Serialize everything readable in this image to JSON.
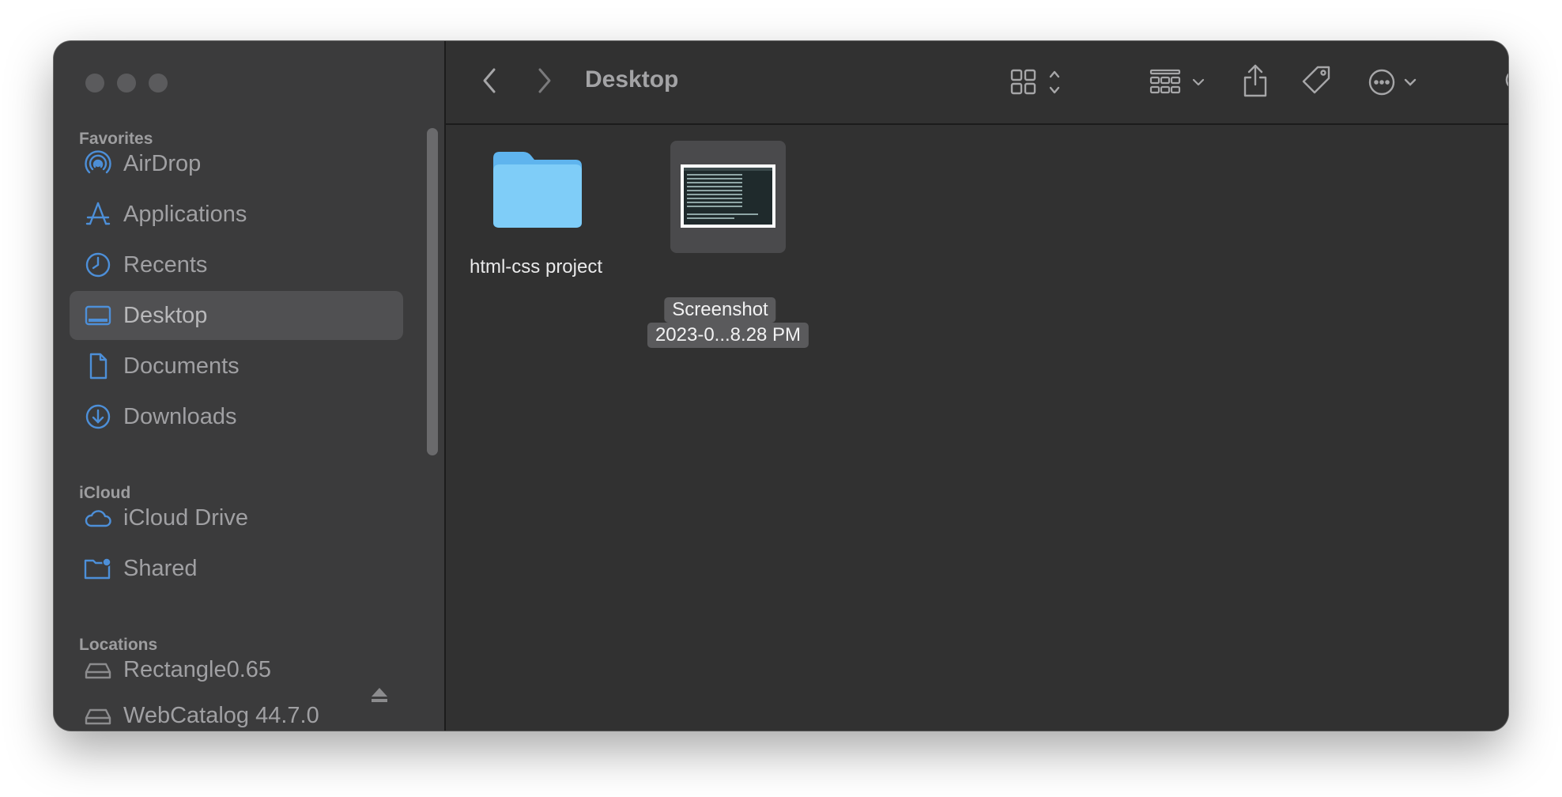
{
  "window": {
    "title": "Desktop"
  },
  "sidebar": {
    "favorites_title": "Favorites",
    "icloud_title": "iCloud",
    "locations_title": "Locations",
    "favorites": [
      {
        "label": "AirDrop",
        "icon": "airdrop-icon"
      },
      {
        "label": "Applications",
        "icon": "applications-icon"
      },
      {
        "label": "Recents",
        "icon": "clock-icon"
      },
      {
        "label": "Desktop",
        "icon": "desktop-icon",
        "selected": true
      },
      {
        "label": "Documents",
        "icon": "document-icon"
      },
      {
        "label": "Downloads",
        "icon": "download-icon"
      }
    ],
    "icloud": [
      {
        "label": "iCloud Drive",
        "icon": "cloud-icon"
      },
      {
        "label": "Shared",
        "icon": "shared-folder-icon"
      }
    ],
    "locations": [
      {
        "label": "Rectangle0.65",
        "icon": "drive-icon"
      },
      {
        "label": "WebCatalog 44.7.0",
        "icon": "drive-icon"
      }
    ]
  },
  "files": [
    {
      "name": "html-css project",
      "kind": "folder"
    },
    {
      "name_line1": "Screenshot",
      "name_line2": "2023-0...8.28 PM",
      "kind": "image",
      "selected": true
    }
  ],
  "colors": {
    "accent": "#4d8fd8",
    "folder": "#7fcdf8",
    "sidebar": "#3b3b3c",
    "content": "#313131"
  }
}
